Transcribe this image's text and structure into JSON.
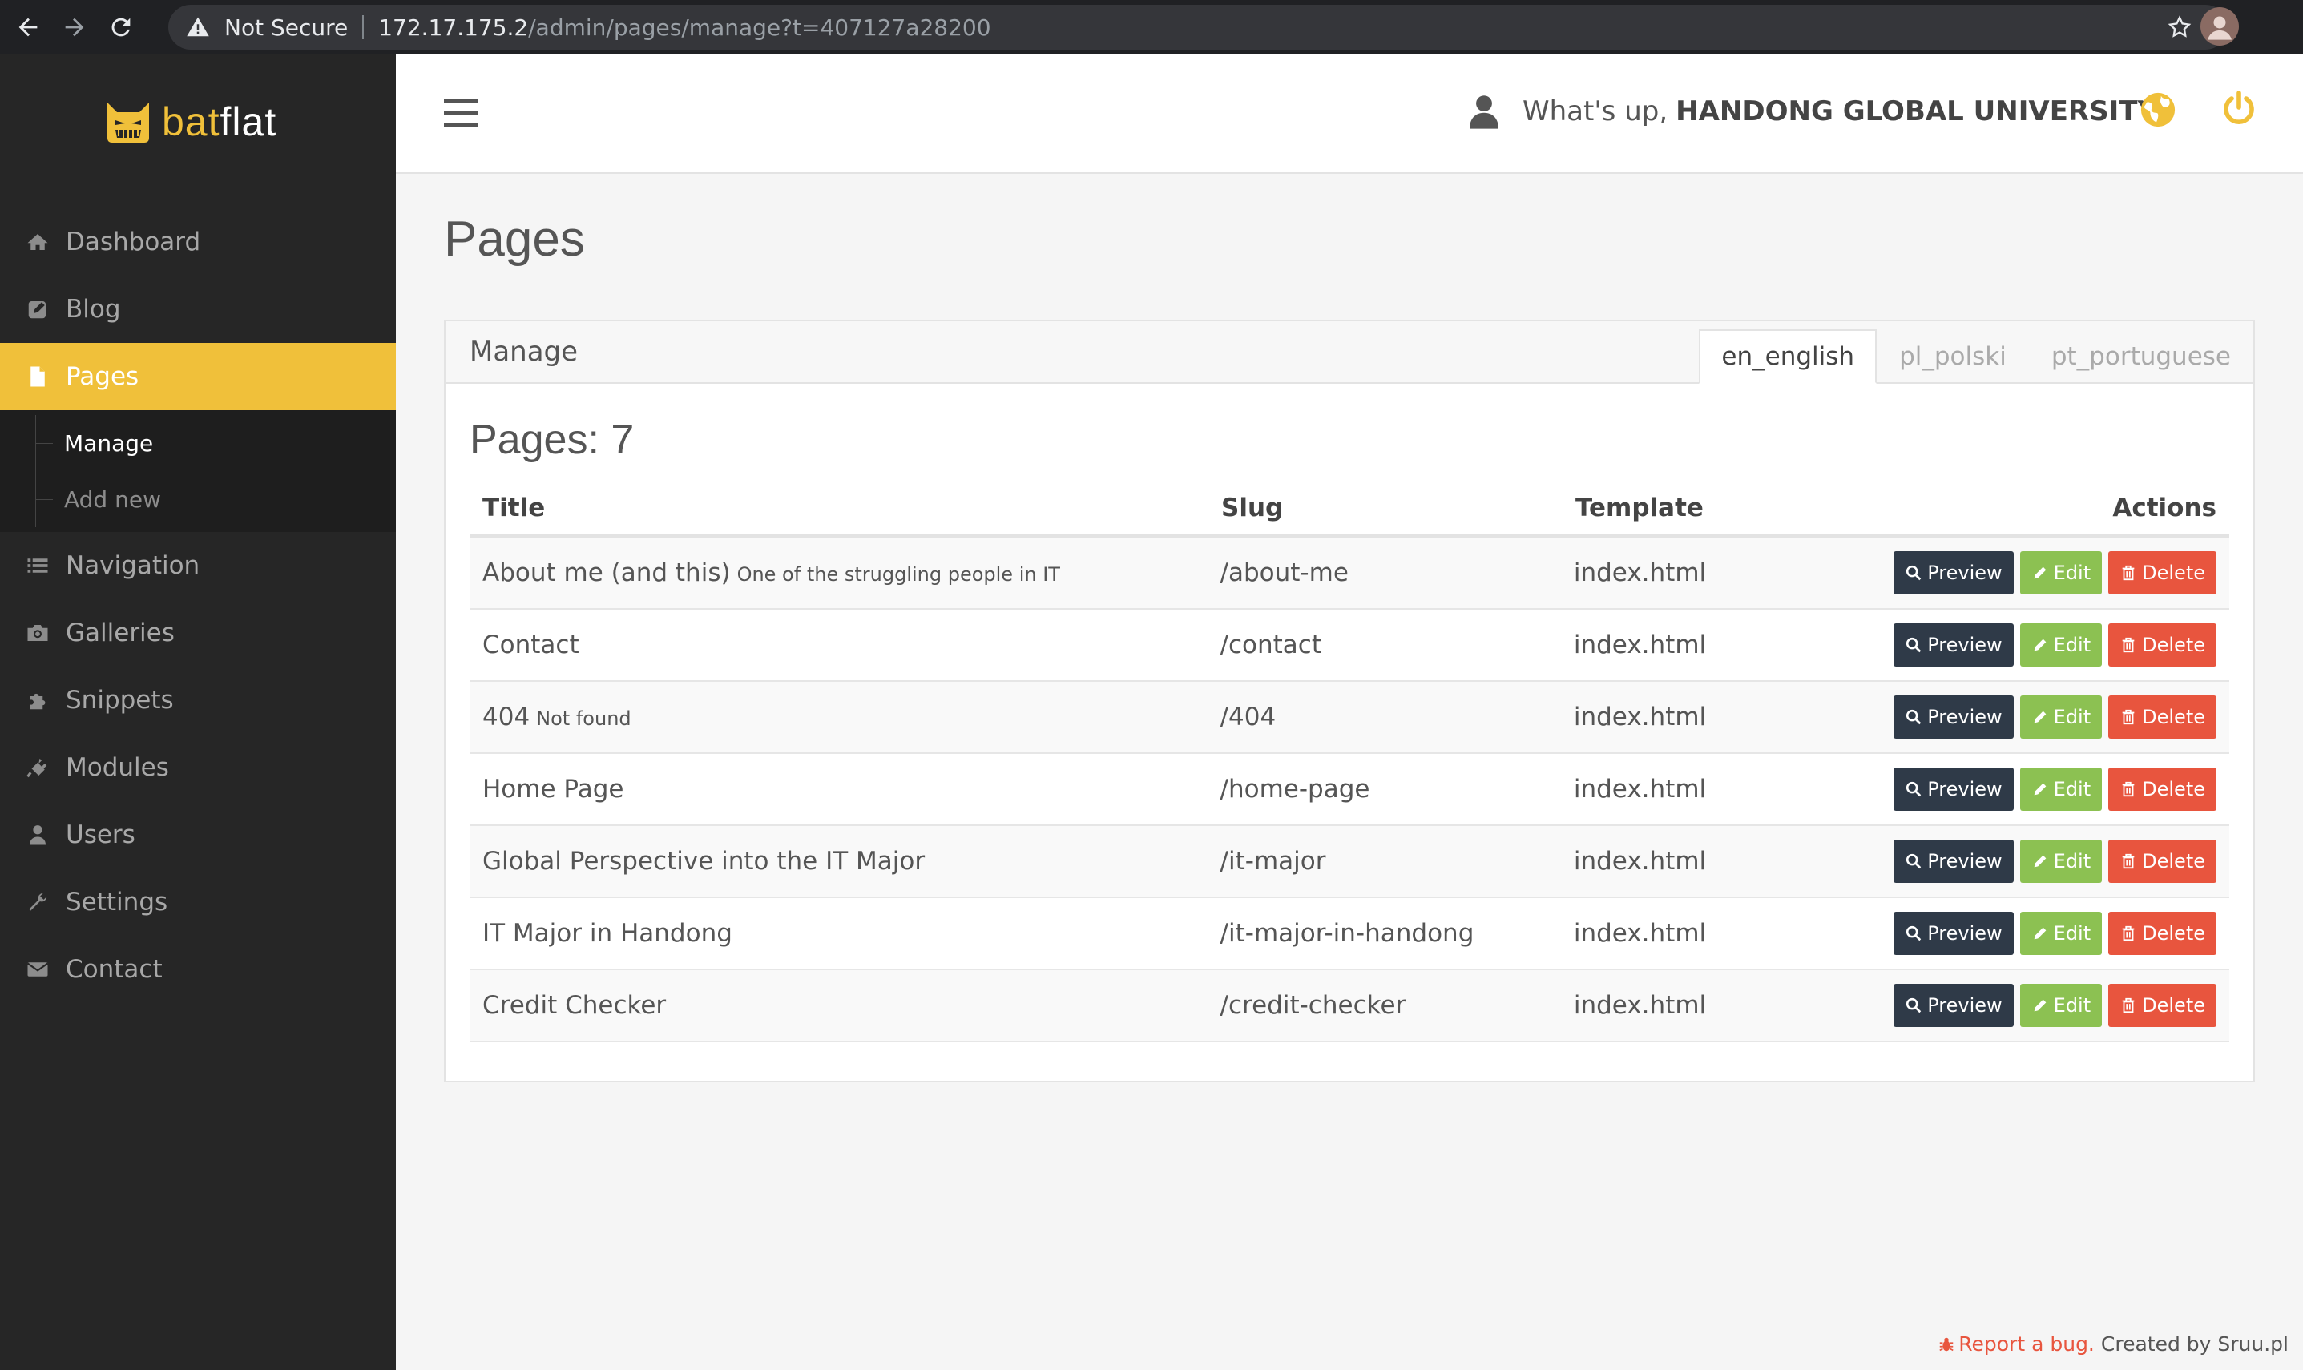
{
  "browser": {
    "security_label": "Not Secure",
    "url_host": "172.17.175.2",
    "url_path": "/admin/pages/manage?t=407127a28200"
  },
  "brand": {
    "part1": "bat",
    "part2": "flat"
  },
  "sidebar": {
    "items": [
      {
        "label": "Dashboard",
        "icon": "home-icon"
      },
      {
        "label": "Blog",
        "icon": "edit-square-icon"
      },
      {
        "label": "Pages",
        "icon": "file-icon",
        "active": true
      },
      {
        "label": "Navigation",
        "icon": "list-icon"
      },
      {
        "label": "Galleries",
        "icon": "camera-icon"
      },
      {
        "label": "Snippets",
        "icon": "puzzle-icon"
      },
      {
        "label": "Modules",
        "icon": "plug-icon"
      },
      {
        "label": "Users",
        "icon": "user-icon"
      },
      {
        "label": "Settings",
        "icon": "wrench-icon"
      },
      {
        "label": "Contact",
        "icon": "envelope-icon"
      }
    ],
    "sub_items": [
      "Manage",
      "Add new"
    ]
  },
  "header": {
    "greeting": "What's up,",
    "user": "HANDONG GLOBAL UNIVERSITY",
    "suffix": "?"
  },
  "page": {
    "title": "Pages",
    "panel_title": "Manage",
    "tabs": [
      "en_english",
      "pl_polski",
      "pt_portuguese"
    ],
    "count_label": "Pages: 7"
  },
  "table": {
    "headers": [
      "Title",
      "Slug",
      "Template",
      "Actions"
    ],
    "rows": [
      {
        "title": "About me (and this)",
        "desc": "One of the struggling people in IT",
        "slug": "/about-me",
        "template": "index.html"
      },
      {
        "title": "Contact",
        "desc": "",
        "slug": "/contact",
        "template": "index.html"
      },
      {
        "title": "404",
        "desc": "Not found",
        "slug": "/404",
        "template": "index.html"
      },
      {
        "title": "Home Page",
        "desc": "",
        "slug": "/home-page",
        "template": "index.html"
      },
      {
        "title": "Global Perspective into the IT Major",
        "desc": "",
        "slug": "/it-major",
        "template": "index.html"
      },
      {
        "title": "IT Major in Handong",
        "desc": "",
        "slug": "/it-major-in-handong",
        "template": "index.html"
      },
      {
        "title": "Credit Checker",
        "desc": "",
        "slug": "/credit-checker",
        "template": "index.html"
      }
    ],
    "actions": {
      "preview": "Preview",
      "edit": "Edit",
      "delete": "Delete"
    }
  },
  "footer": {
    "bug": "Report a bug.",
    "credit": "Created by Sruu.pl"
  },
  "colors": {
    "accent": "#f0c03a",
    "sidebar": "#262626",
    "preview": "#2f3a48",
    "edit": "#8cc152",
    "delete": "#e8553e"
  }
}
